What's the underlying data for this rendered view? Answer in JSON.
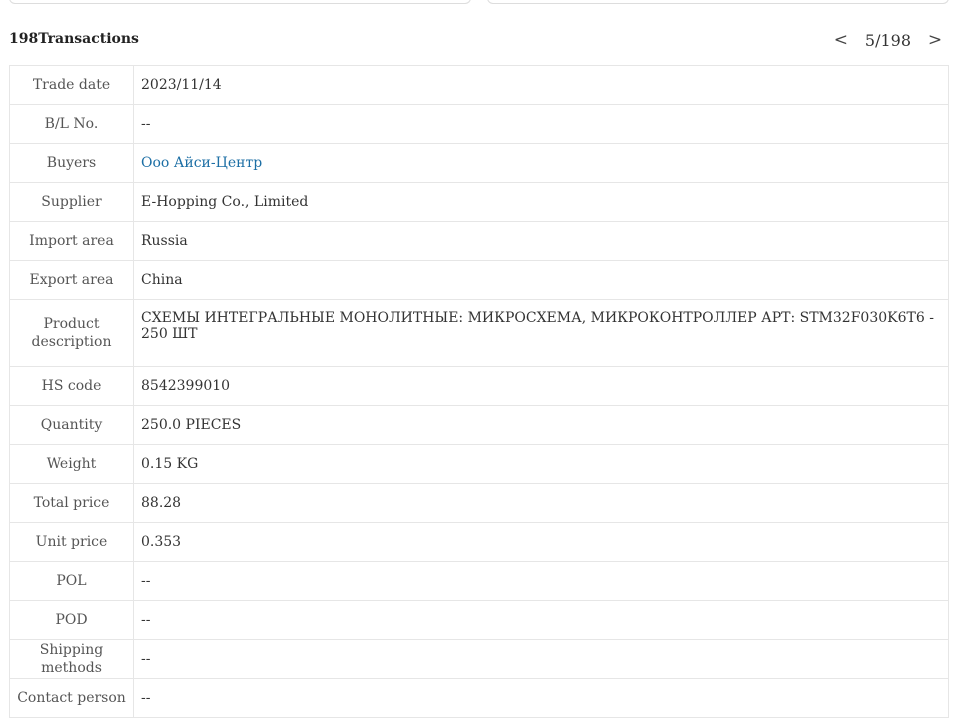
{
  "header": {
    "title": "198Transactions",
    "prev_icon": "<",
    "next_icon": ">",
    "pagination": "5/198"
  },
  "rows": [
    {
      "label": "Trade date",
      "value": "2023/11/14"
    },
    {
      "label": "B/L No.",
      "value": "--"
    },
    {
      "label": "Buyers",
      "value": "Ооо Айси-Центр"
    },
    {
      "label": "Supplier",
      "value": "E-Hopping Co., Limited"
    },
    {
      "label": "Import area",
      "value": "Russia"
    },
    {
      "label": "Export area",
      "value": "China"
    },
    {
      "label_line1": "Product",
      "label_line2": "description",
      "value": "СХЕМЫ ИНТЕГРАЛЬНЫЕ МОНОЛИТНЫЕ: МИКРОСХЕМА, МИКРОКОНТРОЛЛЕР АРТ: STM32F030K6T6 - 250 ШТ"
    },
    {
      "label": "HS code",
      "value": "8542399010"
    },
    {
      "label": "Quantity",
      "value": "250.0 PIECES"
    },
    {
      "label": "Weight",
      "value": "0.15 KG"
    },
    {
      "label": "Total price",
      "value": "88.28"
    },
    {
      "label": "Unit price",
      "value": "0.353"
    },
    {
      "label": "POL",
      "value": "--"
    },
    {
      "label": "POD",
      "value": "--"
    },
    {
      "label": "Shipping methods",
      "value": "--"
    },
    {
      "label": "Contact person",
      "value": "--"
    }
  ],
  "colors": {
    "link": "#1d6fa5",
    "border": "#e6e6e6",
    "label_text": "#555555"
  }
}
